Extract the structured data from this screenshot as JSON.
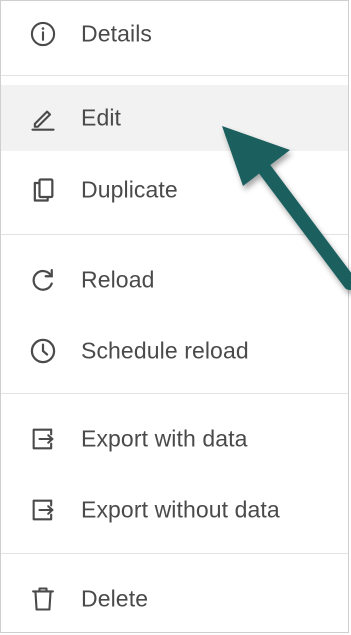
{
  "menu": {
    "items": [
      {
        "label": "Details",
        "icon": "info-icon"
      },
      {
        "label": "Edit",
        "icon": "pencil-icon"
      },
      {
        "label": "Duplicate",
        "icon": "duplicate-icon"
      },
      {
        "label": "Reload",
        "icon": "reload-icon"
      },
      {
        "label": "Schedule reload",
        "icon": "clock-icon"
      },
      {
        "label": "Export with data",
        "icon": "export-icon"
      },
      {
        "label": "Export without data",
        "icon": "export-icon"
      },
      {
        "label": "Delete",
        "icon": "trash-icon"
      }
    ]
  },
  "colors": {
    "text": "#4a4a4a",
    "icon": "#4a4a4a",
    "hover_background": "#f2f2f2",
    "divider": "#e3e3e3",
    "annotation_arrow": "#1a5e5e"
  }
}
